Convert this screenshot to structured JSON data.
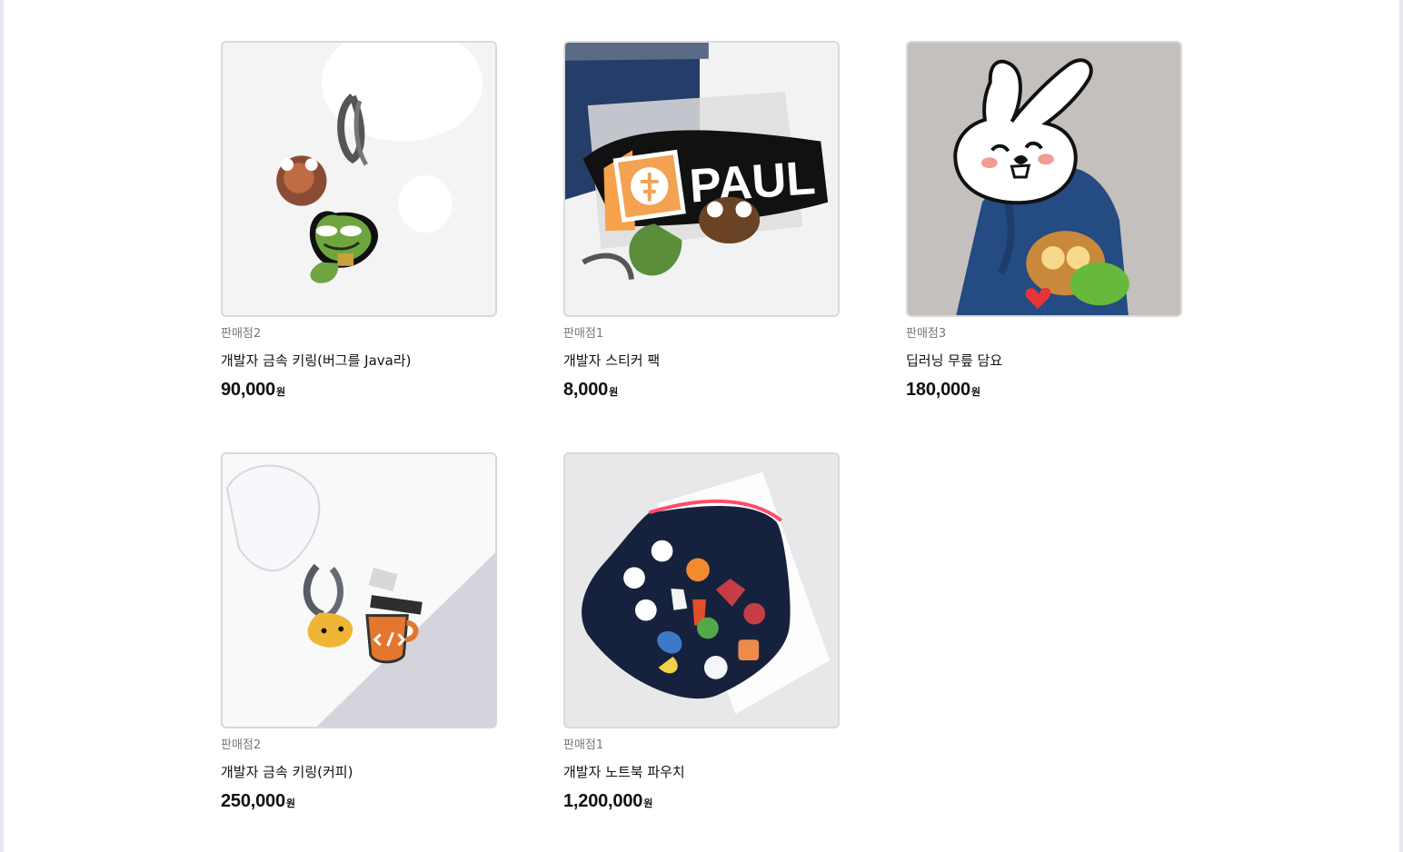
{
  "products": [
    {
      "seller": "판매점2",
      "name": "개발자 금속 키링(버그를 Java라)",
      "price": "90,000",
      "currency": "원",
      "image": "keyring-frog-image"
    },
    {
      "seller": "판매점1",
      "name": "개발자 스티커 팩",
      "price": "8,000",
      "currency": "원",
      "image": "sticker-pack-image",
      "image_text": "PAUL"
    },
    {
      "seller": "판매점3",
      "name": "딥러닝 무릎 담요",
      "price": "180,000",
      "currency": "원",
      "image": "rabbit-blanket-image"
    },
    {
      "seller": "판매점2",
      "name": "개발자 금속 키링(커피)",
      "price": "250,000",
      "currency": "원",
      "image": "keyring-coffee-image"
    },
    {
      "seller": "판매점1",
      "name": "개발자 노트북 파우치",
      "price": "1,200,000",
      "currency": "원",
      "image": "laptop-pouch-image"
    }
  ],
  "colors": {
    "border": "#d9d9d9",
    "seller_text": "#777777",
    "title_text": "#111111",
    "frame": "#e7e6f3"
  }
}
